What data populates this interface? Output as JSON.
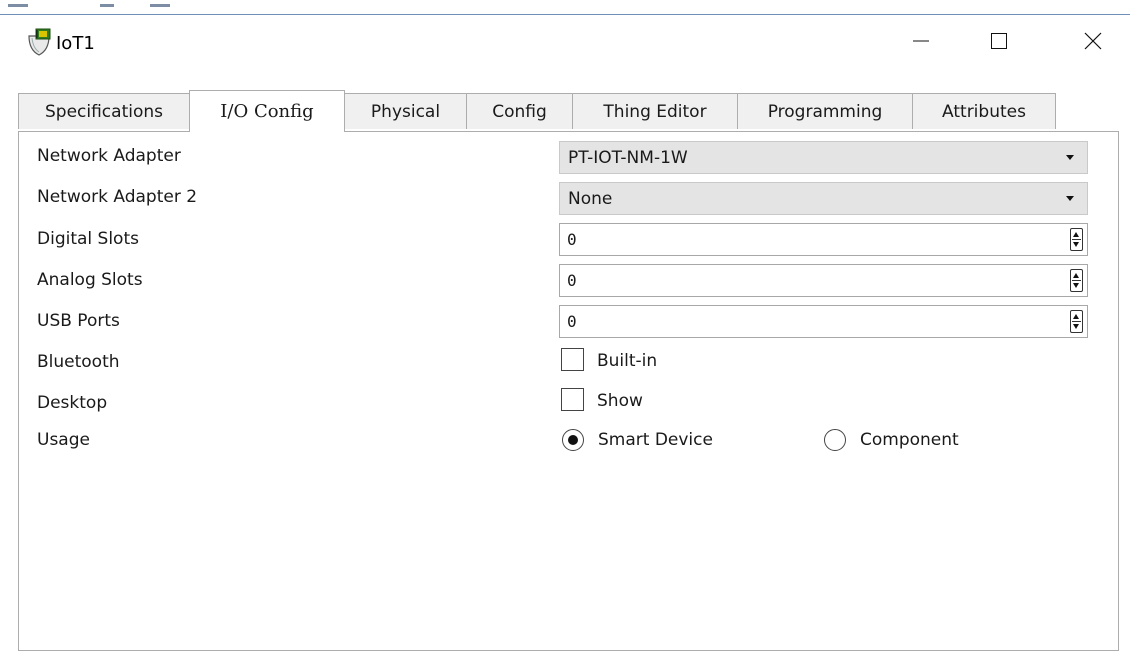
{
  "window": {
    "title": "IoT1",
    "icon": "iot-device-icon",
    "controls": [
      "minimize",
      "maximize",
      "close"
    ]
  },
  "tabs": [
    {
      "label": "Specifications",
      "active": false
    },
    {
      "label": "I/O Config",
      "active": true
    },
    {
      "label": "Physical",
      "active": false
    },
    {
      "label": "Config",
      "active": false
    },
    {
      "label": "Thing Editor",
      "active": false
    },
    {
      "label": "Programming",
      "active": false
    },
    {
      "label": "Attributes",
      "active": false
    }
  ],
  "io_config": {
    "network_adapter": {
      "label": "Network Adapter",
      "value": "PT-IOT-NM-1W"
    },
    "network_adapter_2": {
      "label": "Network Adapter 2",
      "value": "None"
    },
    "digital_slots": {
      "label": "Digital Slots",
      "value": "0"
    },
    "analog_slots": {
      "label": "Analog Slots",
      "value": "0"
    },
    "usb_ports": {
      "label": "USB Ports",
      "value": "0"
    },
    "bluetooth": {
      "label": "Bluetooth",
      "option": "Built-in",
      "checked": false
    },
    "desktop": {
      "label": "Desktop",
      "option": "Show",
      "checked": false
    },
    "usage": {
      "label": "Usage",
      "options": [
        {
          "label": "Smart Device",
          "selected": true
        },
        {
          "label": "Component",
          "selected": false
        }
      ]
    }
  },
  "colors": {
    "dropdown_bg": "#e4e4e4",
    "tab_inactive_bg": "#f0f0f0",
    "border": "#adadad",
    "top_line": "#6f8fb8"
  }
}
